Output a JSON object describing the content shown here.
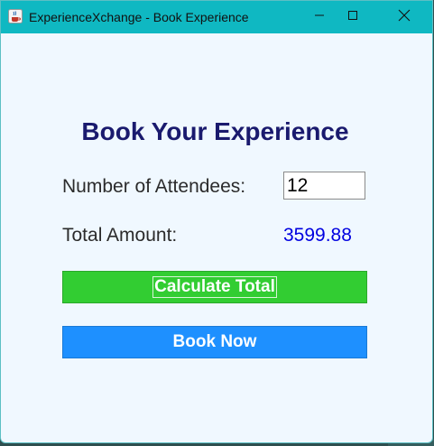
{
  "window": {
    "title": "ExperienceXchange - Book Experience",
    "icons": {
      "app": "java-cup-icon",
      "minimize": "minimize-icon",
      "maximize": "maximize-icon",
      "close": "close-icon"
    }
  },
  "form": {
    "heading": "Book Your Experience",
    "attendees_label": "Number of Attendees:",
    "attendees_value": "12",
    "total_label": "Total Amount:",
    "total_value": "3599.88",
    "calculate_label": "Calculate Total",
    "book_label": "Book Now"
  },
  "colors": {
    "titlebar": "#0fb8c2",
    "background": "#f0f8ff",
    "heading": "#1a1a6e",
    "total_value": "#0000e0",
    "calculate_button": "#32cd32",
    "book_button": "#1e90ff"
  }
}
